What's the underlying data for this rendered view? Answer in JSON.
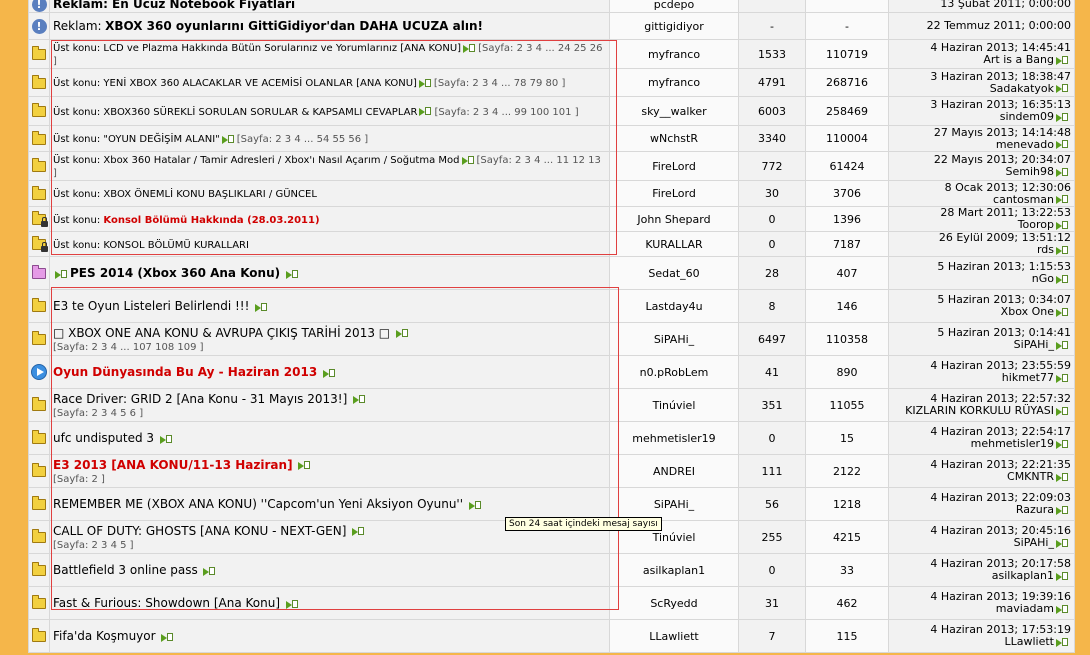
{
  "rows": [
    {
      "type": "ad-top",
      "title": "Reklam: En Ucuz Notebook Fiyatları",
      "author": "pcdepo",
      "replies": "",
      "views": "",
      "last_date": "13 Şubat 2011; 0:00:00",
      "last_user": ""
    },
    {
      "type": "ad",
      "title_prefix": "Reklam:",
      "title": "XBOX 360 oyunlarını GittiGidiyor'dan DAHA UCUZA alın!",
      "author": "gittigidiyor",
      "replies": "-",
      "views": "-",
      "last_date": "22 Temmuz 2011; 0:00:00",
      "last_user": ""
    },
    {
      "type": "sticky",
      "prefix": "Üst konu:",
      "title": "LCD ve Plazma Hakkında Bütün Sorularınız ve Yorumlarınız [ANA KONU]",
      "pages": "[Sayfa: 2 3 4 ... 24 25 26 ]",
      "author": "myfranco",
      "replies": "1533",
      "views": "110719",
      "last_date": "4 Haziran 2013; 14:45:41",
      "last_user": "Art is a Bang"
    },
    {
      "type": "sticky",
      "prefix": "Üst konu:",
      "title": "YENİ XBOX 360 ALACAKLAR VE ACEMİSİ OLANLAR [ANA KONU]",
      "pages": "[Sayfa: 2 3 4 ... 78 79 80 ]",
      "author": "myfranco",
      "replies": "4791",
      "views": "268716",
      "last_date": "3 Haziran 2013; 18:38:47",
      "last_user": "Sadakatyok"
    },
    {
      "type": "sticky",
      "prefix": "Üst konu:",
      "title": "XBOX360 SÜREKLİ SORULAN SORULAR & KAPSAMLI CEVAPLAR",
      "pages": "[Sayfa: 2 3 4 ... 99 100 101 ]",
      "author": "sky__walker",
      "replies": "6003",
      "views": "258469",
      "last_date": "3 Haziran 2013; 16:35:13",
      "last_user": "sindem09"
    },
    {
      "type": "sticky",
      "prefix": "Üst konu:",
      "title": "\"OYUN DEĞİŞİM ALANI\"",
      "pages": "[Sayfa: 2 3 4 ... 54 55 56 ]",
      "author": "wNchstR",
      "replies": "3340",
      "views": "110004",
      "last_date": "27 Mayıs 2013; 14:14:48",
      "last_user": "menevado"
    },
    {
      "type": "sticky",
      "prefix": "Üst konu:",
      "title": "Xbox 360 Hatalar / Tamir Adresleri / Xbox'ı Nasıl Açarım / Soğutma Mod",
      "pages": "[Sayfa: 2 3 4 ... 11 12 13 ]",
      "author": "FireLord",
      "replies": "772",
      "views": "61424",
      "last_date": "22 Mayıs 2013; 20:34:07",
      "last_user": "Semih98"
    },
    {
      "type": "sticky",
      "prefix": "Üst konu:",
      "title": "XBOX ÖNEMLİ KONU BAŞLIKLARI / GÜNCEL",
      "pages": "",
      "author": "FireLord",
      "replies": "30",
      "views": "3706",
      "last_date": "8 Ocak 2013; 12:30:06",
      "last_user": "cantosman"
    },
    {
      "type": "sticky-locked",
      "prefix": "Üst konu:",
      "title": "Konsol Bölümü Hakkında (28.03.2011)",
      "red": true,
      "pages": "",
      "author": "John Shepard",
      "replies": "0",
      "views": "1396",
      "last_date": "28 Mart 2011; 13:22:53",
      "last_user": "Toorop"
    },
    {
      "type": "sticky-locked",
      "prefix": "Üst konu:",
      "title": "KONSOL BÖLÜMÜ KURALLARI",
      "pages": "",
      "author": "KURALLAR",
      "replies": "0",
      "views": "7187",
      "last_date": "26 Eylül 2009; 13:51:12",
      "last_user": "rds"
    },
    {
      "type": "pink",
      "title": "PES 2014 (Xbox 360 Ana Konu)",
      "author": "Sedat_60",
      "replies": "28",
      "views": "407",
      "last_date": "5 Haziran 2013; 1:15:53",
      "last_user": "nGo"
    },
    {
      "type": "normal",
      "title": "E3 te Oyun Listeleri Belirlendi !!!",
      "pages": "",
      "author": "Lastday4u",
      "replies": "8",
      "views": "146",
      "last_date": "5 Haziran 2013; 0:34:07",
      "last_user": "Xbox One"
    },
    {
      "type": "normal",
      "title": "□ XBOX ONE ANA KONU & AVRUPA ÇIKIŞ TARİHİ 2013 □",
      "pages": "[Sayfa: 2 3 4 ... 107 108 109 ]",
      "author": "SiPAHi_",
      "replies": "6497",
      "views": "110358",
      "last_date": "5 Haziran 2013; 0:14:41",
      "last_user": "SiPAHi_"
    },
    {
      "type": "play",
      "title": "Oyun Dünyasında Bu Ay - Haziran 2013",
      "red": true,
      "pages": "",
      "author": "n0.pRobLem",
      "replies": "41",
      "views": "890",
      "last_date": "4 Haziran 2013; 23:55:59",
      "last_user": "hikmet77"
    },
    {
      "type": "normal",
      "title": "Race Driver: GRID 2 [Ana Konu - 31 Mayıs 2013!]",
      "pages": "[Sayfa: 2 3 4 5 6 ]",
      "author": "Tinúviel",
      "replies": "351",
      "views": "11055",
      "last_date": "4 Haziran 2013; 22:57:32",
      "last_user": "KIZLARIN KORKULU RÜYASI"
    },
    {
      "type": "normal",
      "title": "ufc undisputed 3",
      "pages": "",
      "author": "mehmetisler19",
      "replies": "0",
      "views": "15",
      "last_date": "4 Haziran 2013; 22:54:17",
      "last_user": "mehmetisler19"
    },
    {
      "type": "normal",
      "title": "E3 2013 [ANA KONU/11-13 Haziran]",
      "red": true,
      "pages": "[Sayfa: 2 ]",
      "author": "ANDREI",
      "replies": "111",
      "views": "2122",
      "last_date": "4 Haziran 2013; 22:21:35",
      "last_user": "CMKNTR"
    },
    {
      "type": "normal",
      "title": "REMEMBER ME (XBOX ANA KONU) ''Capcom'un Yeni Aksiyon Oyunu''",
      "pages": "",
      "author": "SiPAHi_",
      "replies": "56",
      "views": "1218",
      "last_date": "4 Haziran 2013; 22:09:03",
      "last_user": "Razura"
    },
    {
      "type": "normal",
      "title": "CALL OF DUTY: GHOSTS [ANA KONU - NEXT-GEN]",
      "pages": "[Sayfa: 2 3 4 5 ]",
      "author": "Tinúviel",
      "replies": "255",
      "views": "4215",
      "last_date": "4 Haziran 2013; 20:45:16",
      "last_user": "SiPAHi_"
    },
    {
      "type": "normal",
      "title": "Battlefield 3 online pass",
      "pages": "",
      "author": "asilkaplan1",
      "replies": "0",
      "views": "33",
      "last_date": "4 Haziran 2013; 20:17:58",
      "last_user": "asilkaplan1"
    },
    {
      "type": "normal",
      "title": "Fast & Furious: Showdown [Ana Konu]",
      "pages": "",
      "author": "ScRyedd",
      "replies": "31",
      "views": "462",
      "last_date": "4 Haziran 2013; 19:39:16",
      "last_user": "maviadam"
    },
    {
      "type": "normal",
      "title": "Fifa'da Koşmuyor",
      "pages": "",
      "author": "LLawliett",
      "replies": "7",
      "views": "115",
      "last_date": "4 Haziran 2013; 17:53:19",
      "last_user": "LLawliett"
    }
  ],
  "tooltip": "Son 24 saat içindeki mesaj sayısı"
}
